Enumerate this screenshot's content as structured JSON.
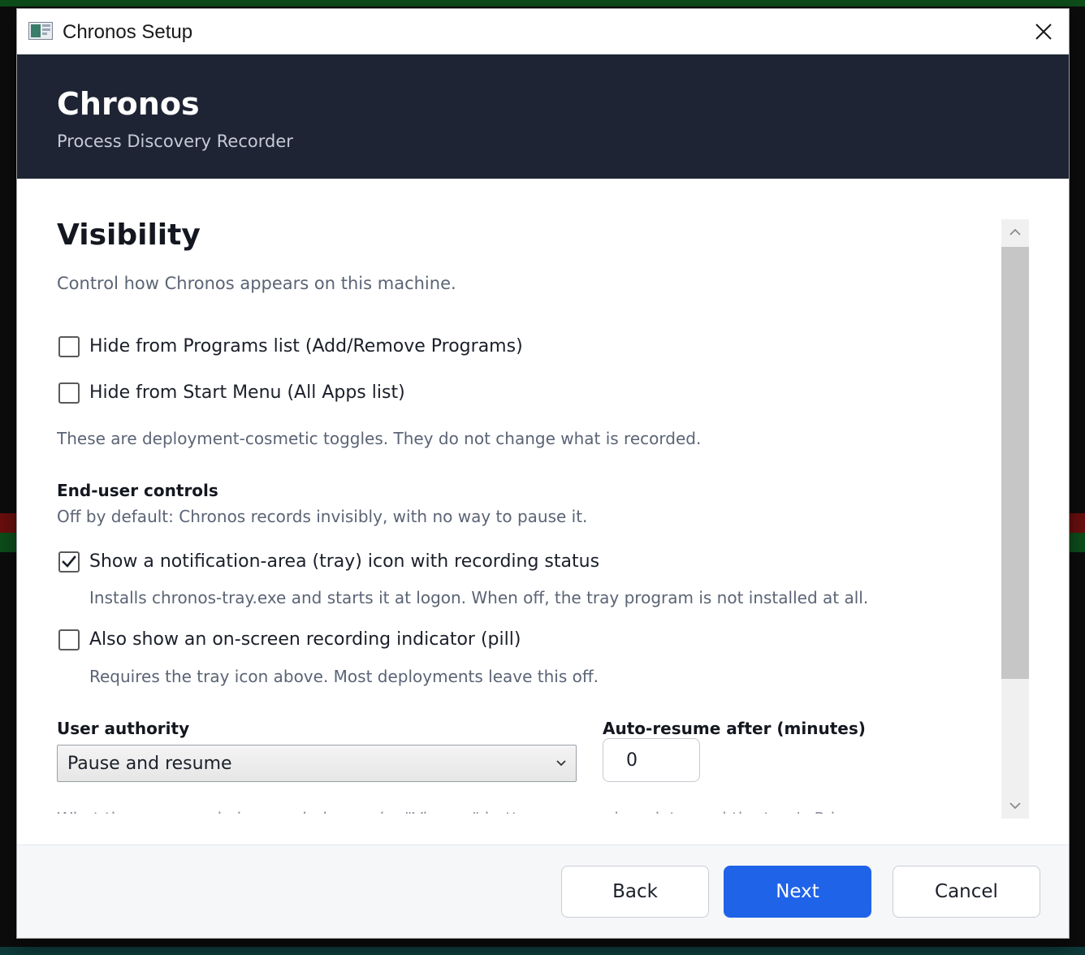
{
  "window": {
    "title": "Chronos Setup"
  },
  "header": {
    "app_name": "Chronos",
    "subtitle": "Process Discovery Recorder"
  },
  "page": {
    "title": "Visibility",
    "description": "Control how Chronos appears on this machine.",
    "options": [
      {
        "label": "Hide from Programs list (Add/Remove Programs)",
        "checked": false
      },
      {
        "label": "Hide from Start Menu (All Apps list)",
        "checked": false
      }
    ],
    "cosmetic_note": "These are deployment-cosmetic toggles. They do not change what is recorded.",
    "end_user": {
      "heading": "End-user controls",
      "description": "Off by default: Chronos records invisibly, with no way to pause it.",
      "tray": {
        "label": "Show a notification-area (tray) icon with recording status",
        "checked": true,
        "note": "Installs chronos-tray.exe and starts it at logon. When off, the tray program is not installed at all."
      },
      "pill": {
        "label": "Also show an on-screen recording indicator (pill)",
        "checked": false,
        "note": "Requires the tray icon above. Most deployments leave this off."
      }
    },
    "authority": {
      "label": "User authority",
      "selected": "Pause and resume"
    },
    "auto_resume": {
      "label": "Auto-resume after (minutes)",
      "value": "0"
    },
    "cutoff_text": "What the user can do is recorded — and a \"View …\" button appears in a data card the tray's Privacy menu"
  },
  "footer": {
    "back_label": "Back",
    "next_label": "Next",
    "cancel_label": "Cancel"
  },
  "colors": {
    "header_bg": "#1e2433",
    "primary_button": "#1f63e8"
  }
}
